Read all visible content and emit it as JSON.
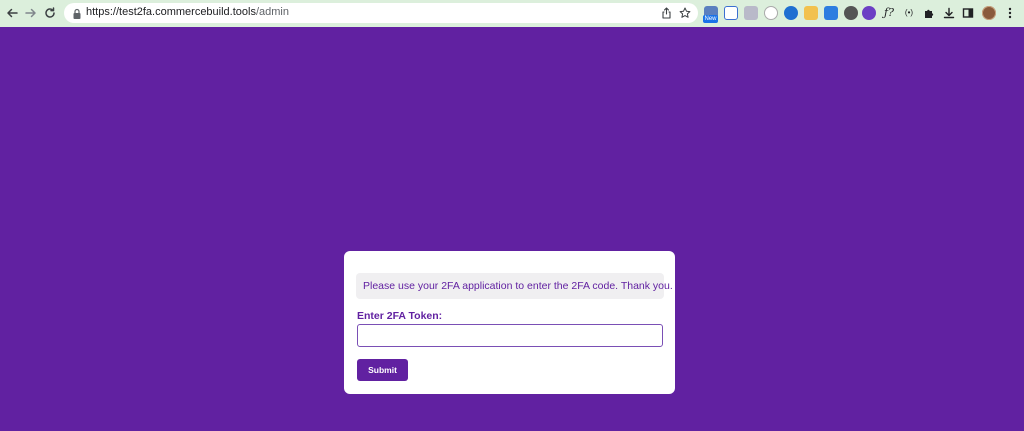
{
  "browser": {
    "url_host": "https://test2fa.commercebuild.tools",
    "url_path": "/admin",
    "new_badge": "New",
    "icons": {
      "back": "back-arrow-icon",
      "forward": "forward-arrow-icon",
      "reload": "reload-icon",
      "lock": "lock-icon",
      "share": "share-icon",
      "bookmark": "star-icon",
      "extensions": "puzzle-icon",
      "downloads": "download-icon",
      "side_panel": "side-panel-icon",
      "menu": "kebab-menu-icon"
    },
    "extension_glyphs": [
      "",
      "",
      "",
      "",
      "",
      "",
      "",
      "",
      "",
      "ƒ?",
      "(•)"
    ]
  },
  "page": {
    "background": "#6121a1",
    "accent": "#6121a1",
    "notice": "Please use your 2FA application to enter the 2FA code. Thank you.",
    "token_label": "Enter 2FA Token:",
    "token_value": "",
    "submit_label": "Submit"
  }
}
